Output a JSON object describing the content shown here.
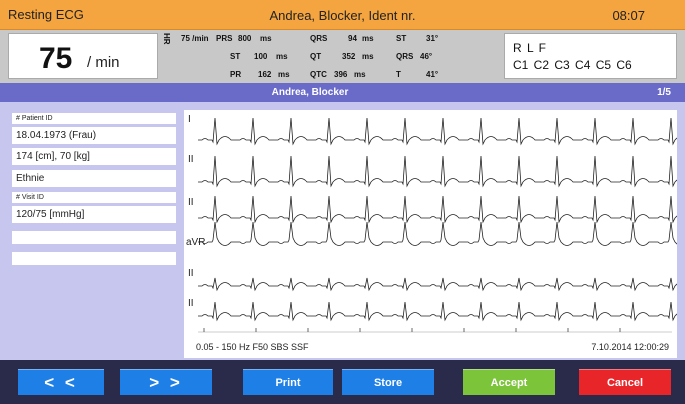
{
  "header": {
    "mode": "Resting ECG",
    "title": "Andrea, Blocker,  Ident nr.",
    "time": "08:07"
  },
  "measures": {
    "heart_rate": "75",
    "heart_rate_unit": "/ min",
    "hr_label": "HR",
    "hr_small": "75 /min",
    "rows": [
      [
        {
          "k": "PRS",
          "v": "800",
          "u": "ms"
        },
        {
          "k": "QRS",
          "v": "94",
          "u": "ms"
        },
        {
          "k": "ST",
          "v": "31°"
        }
      ],
      [
        {
          "k": "ST",
          "v": "100",
          "u": "ms"
        },
        {
          "k": "QT",
          "v": "352",
          "u": "ms"
        },
        {
          "k": "QRS",
          "v": "46°"
        }
      ],
      [
        {
          "k": "PR",
          "v": "162",
          "u": "ms"
        },
        {
          "k": "QTC",
          "v": "396",
          "u": "ms"
        },
        {
          "k": "T",
          "v": "41°"
        }
      ]
    ],
    "leads_line1": "R L F",
    "leads_line2": "C1  C2  C3  C4  C5  C6"
  },
  "patient_bar": {
    "name": "Andrea, Blocker",
    "page": "1/5"
  },
  "patient_info": {
    "patient_id_label": "# Patient ID",
    "dob": "18.04.1973 (Frau)",
    "height_weight": "174 [cm], 70 [kg]",
    "ethnicity": "Ethnie",
    "visit_id_label": "# Visit ID",
    "blood_pressure": "120/75 [mmHg]",
    "extra1": "",
    "extra2": ""
  },
  "ecg": {
    "leads": [
      "I",
      "II",
      "II",
      "aVR",
      "II",
      "II"
    ],
    "filter_info": "0.05 - 150 Hz   F50   SBS  SSF",
    "timestamp": "7.10.2014   12:00:29"
  },
  "buttons": {
    "prev": "< <",
    "next": "> >",
    "print": "Print",
    "store": "Store",
    "accept": "Accept",
    "cancel": "Cancel"
  },
  "colors": {
    "header": "#f5a53f",
    "patient_bar": "#6a6ac8",
    "panel_bg": "#c6c6ef",
    "nav_btn": "#1e7fe6",
    "accept_btn": "#7cc43a",
    "cancel_btn": "#e8262a"
  }
}
